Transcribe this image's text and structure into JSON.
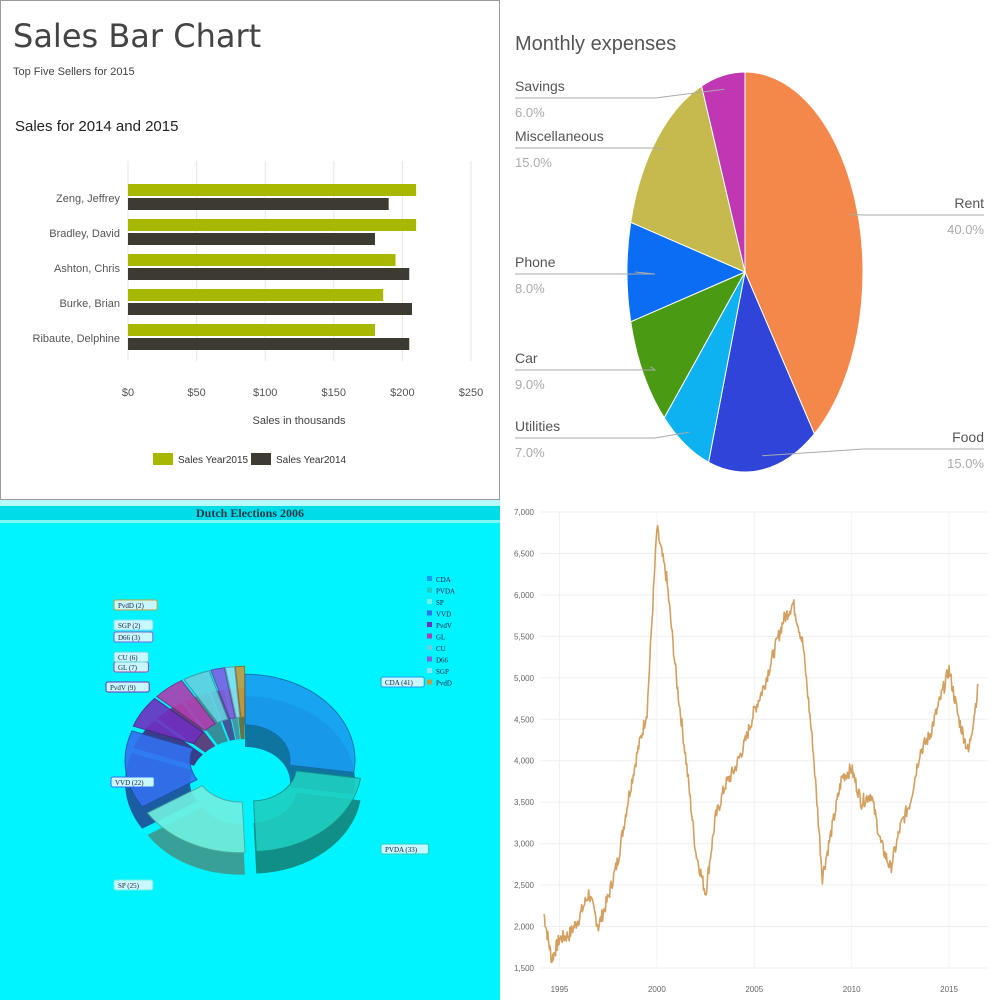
{
  "charts": {
    "sales": {
      "title": "Sales Bar Chart",
      "subtitle": "Top Five Sellers for 2015",
      "chart_title": "Sales for 2014 and 2015",
      "xlabel": "Sales in thousands",
      "ticks": [
        "$0",
        "$50",
        "$100",
        "$150",
        "$200",
        "$250"
      ],
      "legend": [
        "Sales Year2015",
        "Sales Year2014"
      ]
    },
    "expenses": {
      "title": "Monthly expenses",
      "slices": [
        {
          "name": "Rent",
          "pct": "40.0%"
        },
        {
          "name": "Food",
          "pct": "15.0%"
        },
        {
          "name": "Utilities",
          "pct": "7.0%"
        },
        {
          "name": "Car",
          "pct": "9.0%"
        },
        {
          "name": "Phone",
          "pct": "8.0%"
        },
        {
          "name": "Miscellaneous",
          "pct": "15.0%"
        },
        {
          "name": "Savings",
          "pct": "6.0%"
        }
      ]
    },
    "elections": {
      "title": "Dutch Elections 2006",
      "legend": [
        "CDA",
        "PVDA",
        "SP",
        "VVD",
        "PvdV",
        "GL",
        "CU",
        "D66",
        "SGP",
        "PvdD"
      ],
      "labels": [
        "CDA (41)",
        "PVDA (33)",
        "SP (25)",
        "VVD (22)",
        "PvdV (9)",
        "GL (7)",
        "CU (6)",
        "D66 (3)",
        "SGP (2)",
        "PvdD (2)"
      ]
    },
    "index": {
      "y_ticks": [
        "7,000",
        "6,500",
        "6,000",
        "5,500",
        "5,000",
        "4,500",
        "4,000",
        "3,500",
        "3,000",
        "2,500",
        "2,000",
        "1,500"
      ],
      "x_ticks": [
        "1995",
        "2000",
        "2005",
        "2010",
        "2015"
      ]
    }
  },
  "chart_data": [
    {
      "type": "bar",
      "orientation": "horizontal",
      "title": "Sales for 2014 and 2015",
      "xlabel": "Sales in thousands",
      "xlim": [
        0,
        250
      ],
      "categories": [
        "Zeng, Jeffrey",
        "Bradley, David",
        "Ashton, Chris",
        "Burke, Brian",
        "Ribaute, Delphine"
      ],
      "series": [
        {
          "name": "Sales Year2015",
          "color": "#a8b800",
          "values": [
            210,
            210,
            195,
            186,
            180
          ]
        },
        {
          "name": "Sales Year2014",
          "color": "#3d3a32",
          "values": [
            190,
            180,
            205,
            207,
            205
          ]
        }
      ],
      "grid": true,
      "legend": "bottom"
    },
    {
      "type": "pie",
      "title": "Monthly expenses",
      "categories": [
        "Rent",
        "Food",
        "Utilities",
        "Car",
        "Phone",
        "Miscellaneous",
        "Savings"
      ],
      "values": [
        40,
        15,
        7,
        9,
        8,
        15,
        6
      ],
      "colors": [
        "#f4884a",
        "#2f44d8",
        "#0fb2f0",
        "#4b9a14",
        "#0b6cf4",
        "#c6b94d",
        "#c037b4"
      ]
    },
    {
      "type": "pie",
      "title": "Dutch Elections 2006",
      "categories": [
        "CDA",
        "PVDA",
        "SP",
        "VVD",
        "PvdV",
        "GL",
        "CU",
        "D66",
        "SGP",
        "PvdD"
      ],
      "values": [
        41,
        33,
        25,
        22,
        9,
        7,
        6,
        3,
        2,
        2
      ],
      "colors": [
        "#1a9cf0",
        "#1fcfc0",
        "#70f0e0",
        "#3370f0",
        "#7030c0",
        "#b03eb0",
        "#66d0e0",
        "#8060e0",
        "#88e0f0",
        "#c89a3c"
      ],
      "legend": "right"
    },
    {
      "type": "line",
      "ylim": [
        1500,
        7000
      ],
      "xlim": [
        1994,
        2017
      ],
      "color": "#d4a060",
      "x": [
        1994.2,
        1994.6,
        1995.0,
        1995.5,
        1996.0,
        1996.5,
        1997.0,
        1997.5,
        1998.0,
        1998.5,
        1999.0,
        1999.5,
        2000.0,
        2000.5,
        2001.0,
        2001.5,
        2002.0,
        2002.5,
        2003.0,
        2003.5,
        2004.0,
        2004.5,
        2005.0,
        2005.5,
        2006.0,
        2006.5,
        2007.0,
        2007.5,
        2008.0,
        2008.5,
        2009.0,
        2009.5,
        2010.0,
        2010.5,
        2011.0,
        2011.5,
        2012.0,
        2012.5,
        2013.0,
        2013.5,
        2014.0,
        2014.5,
        2015.0,
        2015.5,
        2016.0,
        2016.5
      ],
      "y": [
        2150,
        1600,
        1850,
        1900,
        2100,
        2400,
        2000,
        2350,
        2800,
        3500,
        4100,
        4600,
        6800,
        6200,
        5000,
        4000,
        2900,
        2400,
        3300,
        3700,
        3900,
        4200,
        4600,
        4900,
        5300,
        5700,
        5900,
        5400,
        4200,
        2600,
        3200,
        3800,
        3900,
        3500,
        3600,
        3000,
        2700,
        3200,
        3500,
        4100,
        4300,
        4700,
        5100,
        4500,
        4100,
        4900
      ]
    }
  ]
}
